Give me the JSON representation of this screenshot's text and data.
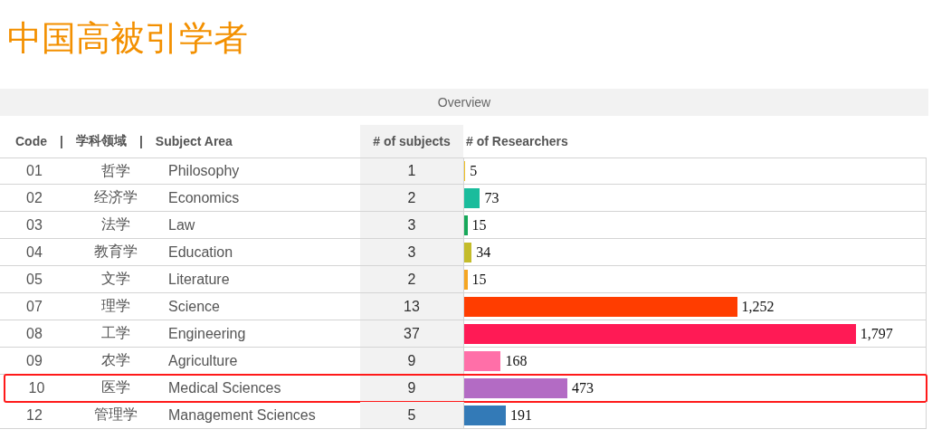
{
  "title": "中国高被引学者",
  "overview": "Overview",
  "columns": {
    "code": "Code",
    "sep1": "|",
    "cn": "学科领域",
    "sep2": "|",
    "en": "Subject Area",
    "subjects": "# of subjects",
    "researchers": "# of Researchers"
  },
  "rows": [
    {
      "code": "01",
      "cn": "哲学",
      "en": "Philosophy",
      "subjects": "1",
      "researchers": "5",
      "level": 0.0024,
      "color": "#f0c020",
      "highlighted": false
    },
    {
      "code": "02",
      "cn": "经济学",
      "en": "Economics",
      "subjects": "2",
      "researchers": "73",
      "level": 0.034,
      "color": "#1abc9c",
      "highlighted": false
    },
    {
      "code": "03",
      "cn": "法学",
      "en": "Law",
      "subjects": "3",
      "researchers": "15",
      "level": 0.0071,
      "color": "#17a85a",
      "highlighted": false
    },
    {
      "code": "04",
      "cn": "教育学",
      "en": "Education",
      "subjects": "3",
      "researchers": "34",
      "level": 0.016,
      "color": "#c4bc2a",
      "highlighted": false
    },
    {
      "code": "05",
      "cn": "文学",
      "en": "Literature",
      "subjects": "2",
      "researchers": "15",
      "level": 0.0071,
      "color": "#f5a623",
      "highlighted": false
    },
    {
      "code": "07",
      "cn": "理学",
      "en": "Science",
      "subjects": "13",
      "researchers": "1,252",
      "level": 0.59,
      "color": "#ff3d00",
      "highlighted": false
    },
    {
      "code": "08",
      "cn": "工学",
      "en": "Engineering",
      "subjects": "37",
      "researchers": "1,797",
      "level": 0.847,
      "color": "#ff1a55",
      "highlighted": false
    },
    {
      "code": "09",
      "cn": "农学",
      "en": "Agriculture",
      "subjects": "9",
      "researchers": "168",
      "level": 0.079,
      "color": "#ff6fa8",
      "highlighted": false
    },
    {
      "code": "10",
      "cn": "医学",
      "en": "Medical Sciences",
      "subjects": "9",
      "researchers": "473",
      "level": 0.223,
      "color": "#b36bc4",
      "highlighted": true
    },
    {
      "code": "12",
      "cn": "管理学",
      "en": "Management Sciences",
      "subjects": "5",
      "researchers": "191",
      "level": 0.09,
      "color": "#337ab7",
      "highlighted": false
    }
  ]
}
